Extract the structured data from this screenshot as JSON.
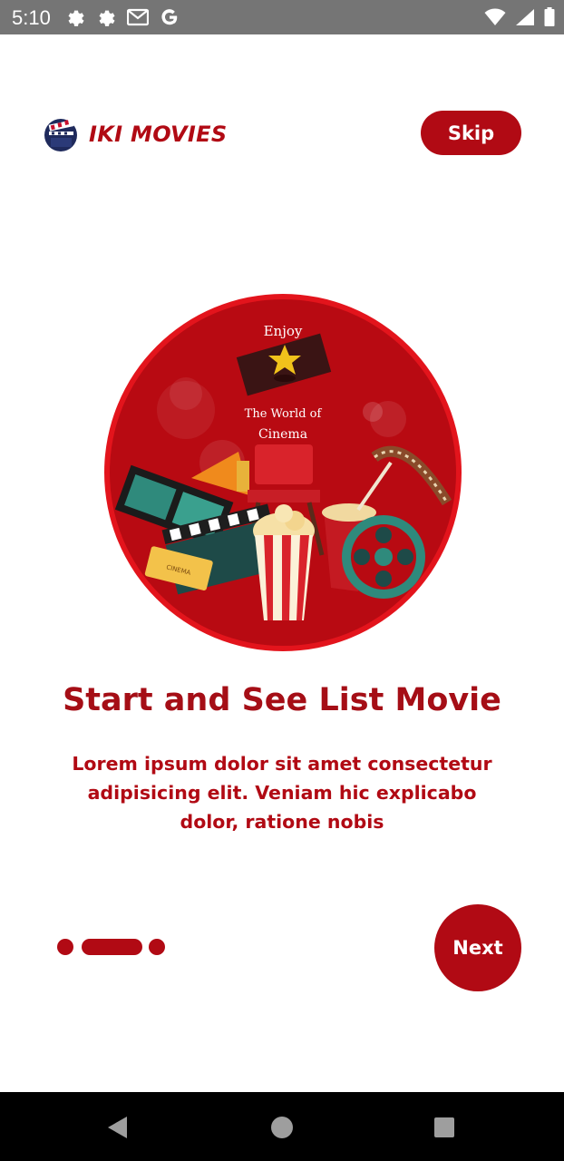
{
  "status_bar": {
    "time": "5:10",
    "left_icons": [
      "settings-icon",
      "settings-icon",
      "gmail-icon",
      "google-icon"
    ],
    "right_icons": [
      "wifi-icon",
      "signal-icon",
      "battery-icon"
    ]
  },
  "header": {
    "app_name": "IKI MOVIES",
    "logo_icon": "clapperboard-icon",
    "skip_label": "Skip"
  },
  "illustration": {
    "line1": "Enjoy",
    "line2": "The World of",
    "line3": "Cinema",
    "ticket_text": "CINEMA"
  },
  "onboarding": {
    "title": "Start and See List Movie",
    "description": "Lorem ipsum dolor sit amet consectetur adipisicing elit. Veniam hic explicabo dolor, ratione nobis",
    "page_count": 3,
    "active_page": 2,
    "next_label": "Next"
  },
  "navigation_bar": {
    "buttons": [
      "back-icon",
      "home-icon",
      "recents-icon"
    ]
  },
  "colors": {
    "primary": "#b10a14",
    "title": "#a50e16",
    "status_bar": "#757575",
    "nav_bar": "#000000"
  }
}
